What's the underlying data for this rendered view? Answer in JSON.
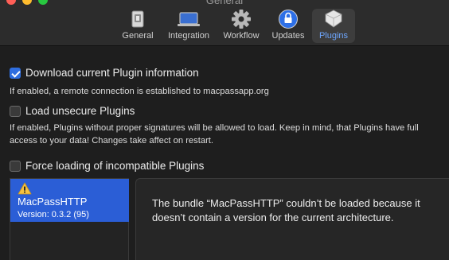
{
  "window": {
    "title": "General"
  },
  "toolbar": {
    "tabs": [
      {
        "label": "General",
        "icon": "general-icon"
      },
      {
        "label": "Integration",
        "icon": "integration-icon"
      },
      {
        "label": "Workflow",
        "icon": "workflow-icon"
      },
      {
        "label": "Updates",
        "icon": "updates-icon"
      },
      {
        "label": "Plugins",
        "icon": "plugins-icon",
        "active": true
      }
    ]
  },
  "options": {
    "download_info": {
      "label": "Download current Plugin information",
      "checked": true,
      "description": "If enabled, a remote connection is established to macpassapp.org"
    },
    "load_unsecure": {
      "label": "Load unsecure Plugins",
      "checked": false,
      "description": "If enabled, Plugins without proper signatures will be allowed to load. Keep in mind, that Plugins have full access to your data! Changes take affect on restart."
    },
    "force_incompatible": {
      "label": "Force loading of incompatible Plugins",
      "checked": false
    }
  },
  "plugins": {
    "items": [
      {
        "name": "MacPassHTTP",
        "version": "Version: 0.3.2 (95)",
        "status_icon": "warning-icon"
      }
    ],
    "detail_message": "The bundle “MacPassHTTP” couldn’t be loaded because it doesn’t contain a version for the current architecture."
  },
  "colors": {
    "accent": "#2f6ee0",
    "selection": "#2b5ed6",
    "active_tab_label": "#6ea7ff",
    "warning": "#f5c242"
  }
}
